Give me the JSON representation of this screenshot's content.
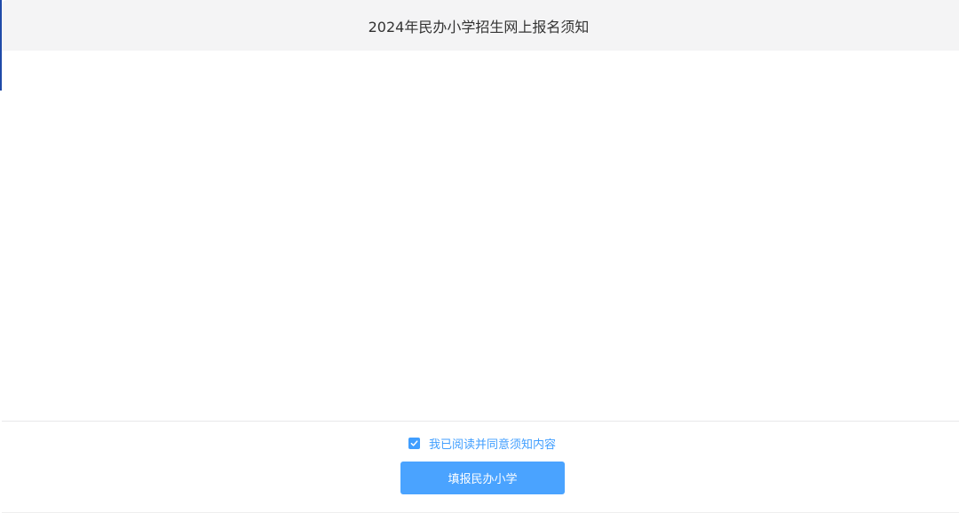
{
  "dialog": {
    "title": "2024年民办小学招生网上报名须知"
  },
  "footer": {
    "agree": {
      "checked": true,
      "label": "我已阅读并同意须知内容"
    },
    "submit_label": "填报民办小学"
  },
  "colors": {
    "accent": "#409eff",
    "button": "#4aa3ff",
    "header_bg": "#f4f4f5",
    "left_accent": "#1f4aa8"
  },
  "icons": {
    "checkbox": "check-icon"
  }
}
